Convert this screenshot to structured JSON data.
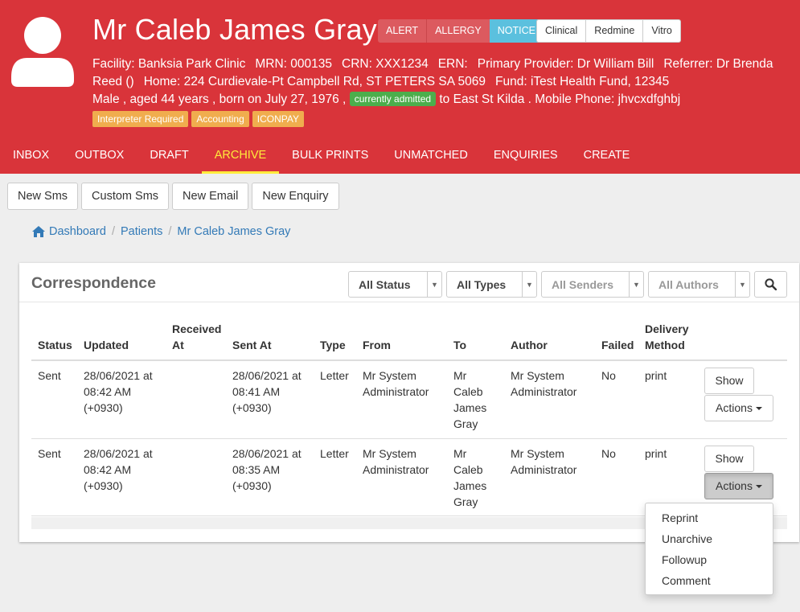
{
  "patient": {
    "name": "Mr Caleb James Gray",
    "flags": [
      "ALERT",
      "ALLERGY",
      "NOTICE"
    ],
    "links": [
      "Clinical",
      "Redmine",
      "Vitro"
    ],
    "facility": "Facility: Banksia Park Clinic",
    "mrn": "MRN: 000135",
    "crn": "CRN: XXX1234",
    "ern": "ERN:",
    "provider": "Primary Provider: Dr William Bill",
    "referrer": "Referrer: Dr Brenda Reed ()",
    "home": "Home: 224 Curdievale-Pt Campbell Rd, ST PETERS SA 5069",
    "fund": "Fund: iTest Health Fund, 12345",
    "demographics": "Male , aged 44 years , born on July 27, 1976 ,",
    "admitted_badge": "currently admitted",
    "admitted_to": "to East St Kilda . Mobile Phone: jhvcxdfghbj",
    "badges": [
      "Interpreter Required",
      "Accounting",
      "ICONPAY"
    ]
  },
  "nav": [
    "INBOX",
    "OUTBOX",
    "DRAFT",
    "ARCHIVE",
    "BULK PRINTS",
    "UNMATCHED",
    "ENQUIRIES",
    "CREATE"
  ],
  "nav_active": "ARCHIVE",
  "actions": [
    "New Sms",
    "Custom Sms",
    "New Email",
    "New Enquiry"
  ],
  "breadcrumb": [
    "Dashboard",
    "Patients",
    "Mr Caleb James Gray"
  ],
  "panel": {
    "title": "Correspondence",
    "filters": [
      "All Status",
      "All Types",
      "All Senders",
      "All Authors"
    ]
  },
  "table": {
    "headers": {
      "status": "Status",
      "updated": "Updated",
      "received1": "Received",
      "received2": "At",
      "sent": "Sent At",
      "type": "Type",
      "from": "From",
      "to": "To",
      "author": "Author",
      "failed": "Failed",
      "delivery1": "Delivery",
      "delivery2": "Method"
    },
    "rows": [
      {
        "status": "Sent",
        "updated": [
          "28/06/2021 at",
          "08:42 AM",
          "(+0930)"
        ],
        "sent": [
          "28/06/2021 at",
          "08:41 AM",
          "(+0930)"
        ],
        "type": "Letter",
        "from": [
          "Mr System",
          "Administrator"
        ],
        "to": [
          "Mr",
          "Caleb",
          "James",
          "Gray"
        ],
        "author": [
          "Mr System",
          "Administrator"
        ],
        "failed": "No",
        "delivery": "print"
      },
      {
        "status": "Sent",
        "updated": [
          "28/06/2021 at",
          "08:42 AM",
          "(+0930)"
        ],
        "sent": [
          "28/06/2021 at",
          "08:35 AM",
          "(+0930)"
        ],
        "type": "Letter",
        "from": [
          "Mr System",
          "Administrator"
        ],
        "to": [
          "Mr",
          "Caleb",
          "James",
          "Gray"
        ],
        "author": [
          "Mr System",
          "Administrator"
        ],
        "failed": "No",
        "delivery": "print"
      }
    ],
    "show_label": "Show",
    "actions_label": "Actions"
  },
  "menu": [
    "Reprint",
    "Unarchive",
    "Followup",
    "Comment"
  ]
}
